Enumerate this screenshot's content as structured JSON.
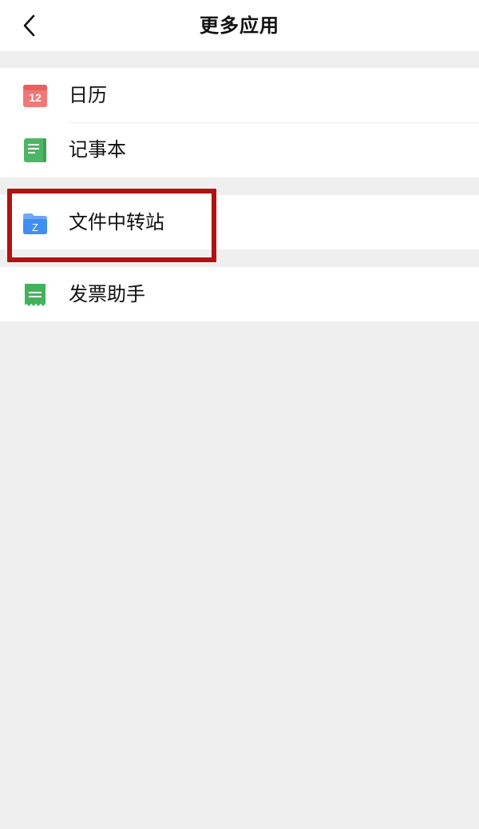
{
  "header": {
    "title": "更多应用",
    "back_icon": "chevron-left-icon"
  },
  "groups": [
    {
      "items": [
        {
          "label": "日历",
          "icon": "calendar-icon",
          "icon_text": "12",
          "icon_color": "#f16c6c"
        },
        {
          "label": "记事本",
          "icon": "notepad-icon",
          "icon_color": "#4db665"
        }
      ]
    },
    {
      "items": [
        {
          "label": "文件中转站",
          "icon": "folder-icon",
          "icon_text": "Z",
          "icon_color": "#3f8ef2",
          "highlighted": true
        }
      ]
    },
    {
      "items": [
        {
          "label": "发票助手",
          "icon": "receipt-icon",
          "icon_color": "#43b35b"
        }
      ]
    }
  ],
  "colors": {
    "background": "#efefef",
    "surface": "#ffffff",
    "highlight_border": "#b01310"
  }
}
